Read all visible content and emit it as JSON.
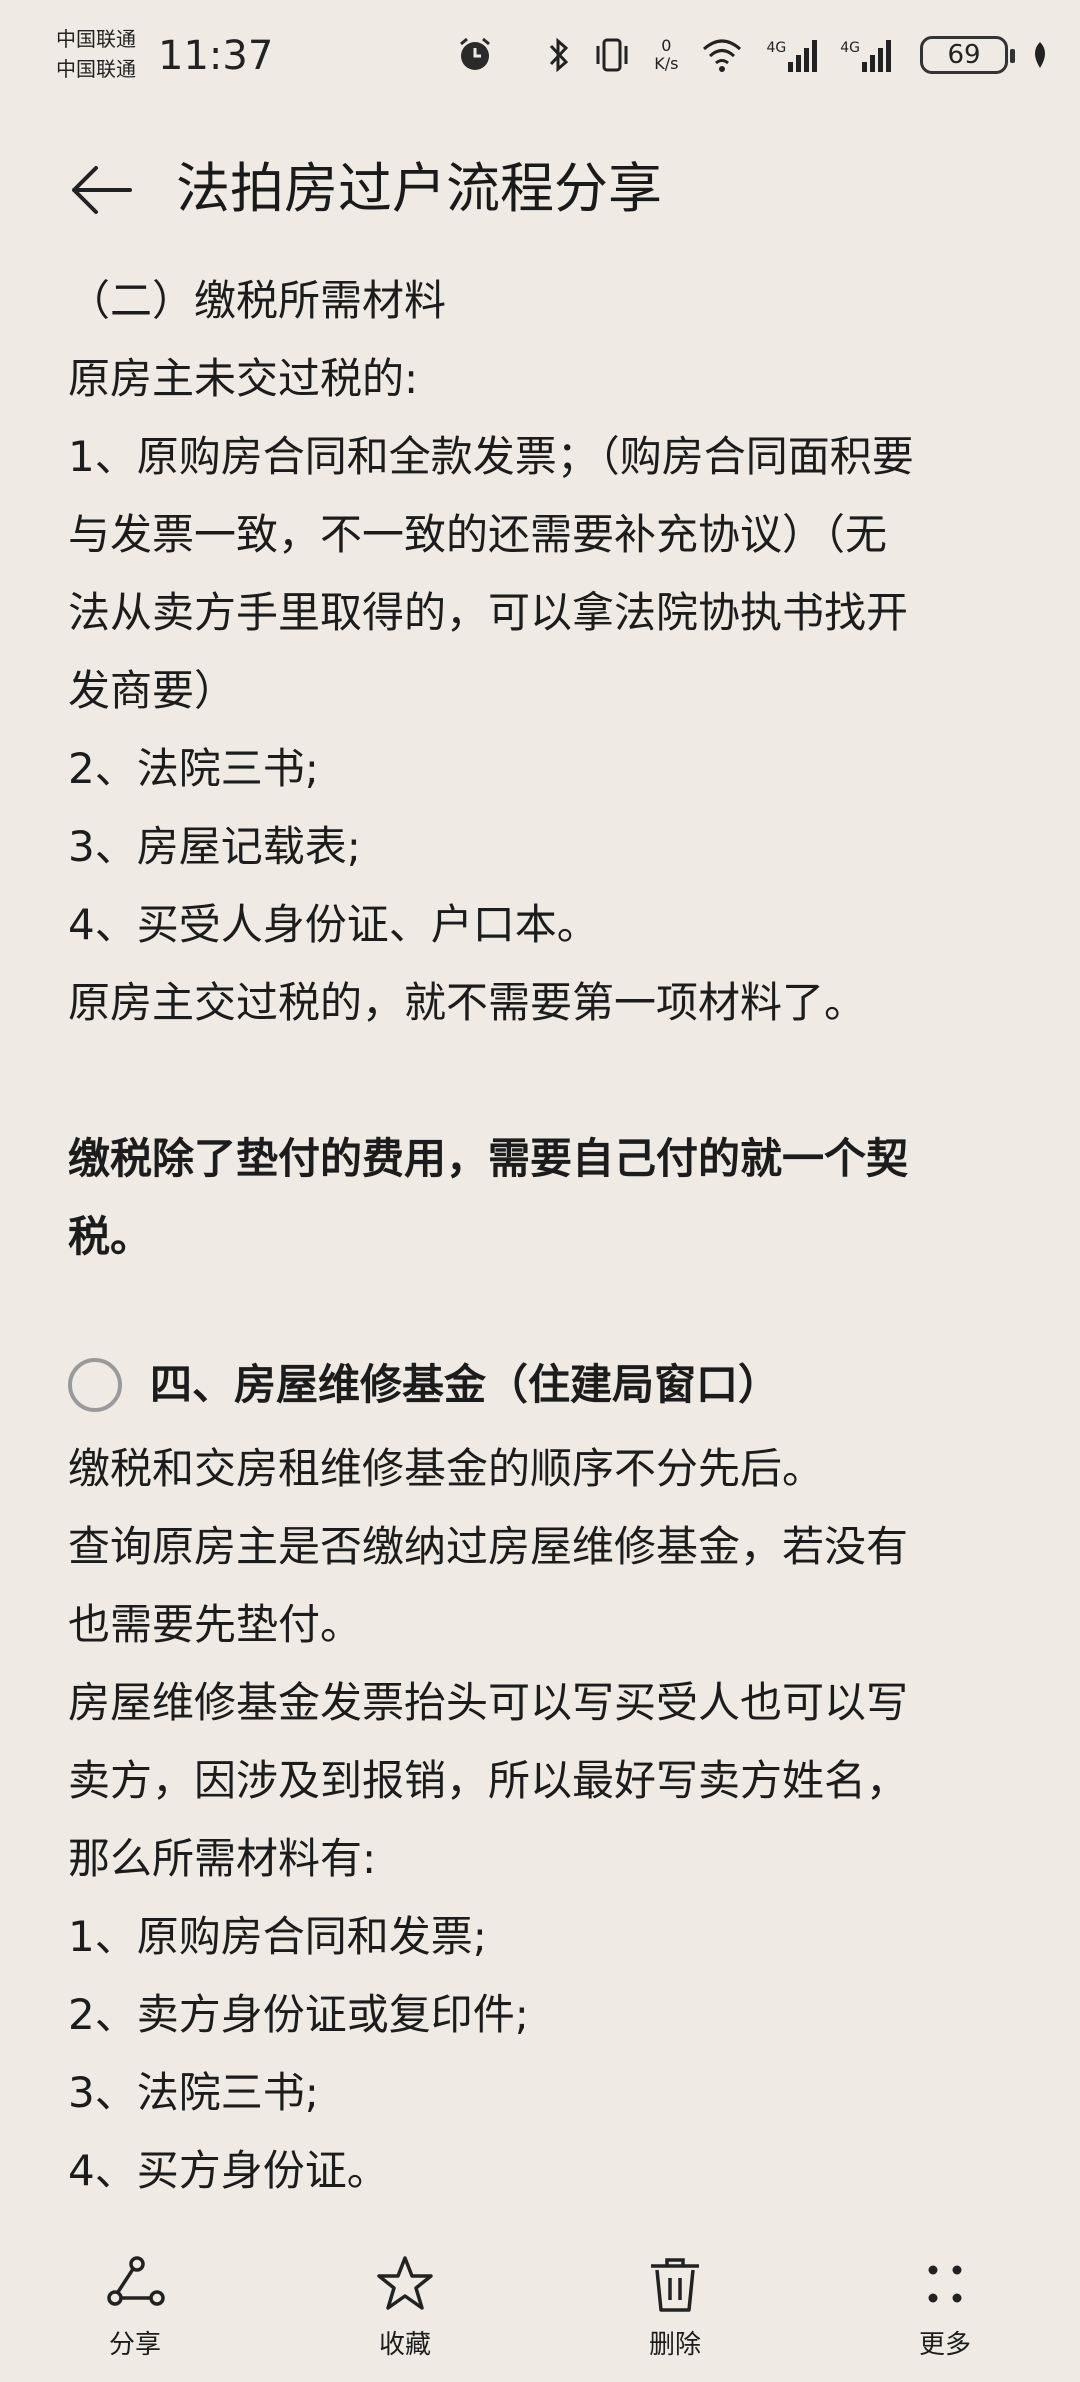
{
  "status_bar": {
    "carrier_1": "中国联通",
    "carrier_2": "中国联通",
    "time": "11:37",
    "net_speed_value": "0",
    "net_speed_unit": "K/s",
    "signal_1_label": "4G",
    "signal_2_label": "4G",
    "battery_level": "69"
  },
  "header": {
    "title": "法拍房过户流程分享"
  },
  "content": {
    "lines_a": [
      "（二）缴税所需材料",
      "原房主未交过税的:",
      "1、原购房合同和全款发票；（购房合同面积要",
      "与发票一致，不一致的还需要补充协议）（无",
      "法从卖方手里取得的，可以拿法院协执书找开",
      "发商要）",
      "2、法院三书;",
      "3、房屋记载表;",
      "4、买受人身份证、户口本。",
      "原房主交过税的，就不需要第一项材料了。"
    ],
    "bold_note_1": "缴税除了垫付的费用，需要自己付的就一个契",
    "bold_note_2": "税。",
    "section_heading": "四、房屋维修基金（住建局窗口）",
    "lines_b": [
      "缴税和交房租维修基金的顺序不分先后。",
      "查询原房主是否缴纳过房屋维修基金，若没有",
      "也需要先垫付。",
      "房屋维修基金发票抬头可以写买受人也可以写",
      "卖方，因涉及到报销，所以最好写卖方姓名，",
      "那么所需材料有:",
      "1、原购房合同和发票;",
      "2、卖方身份证或复印件;",
      "3、法院三书;",
      "4、买方身份证。"
    ]
  },
  "bottom_bar": {
    "share_label": "分享",
    "favorite_label": "收藏",
    "delete_label": "删除",
    "more_label": "更多"
  }
}
